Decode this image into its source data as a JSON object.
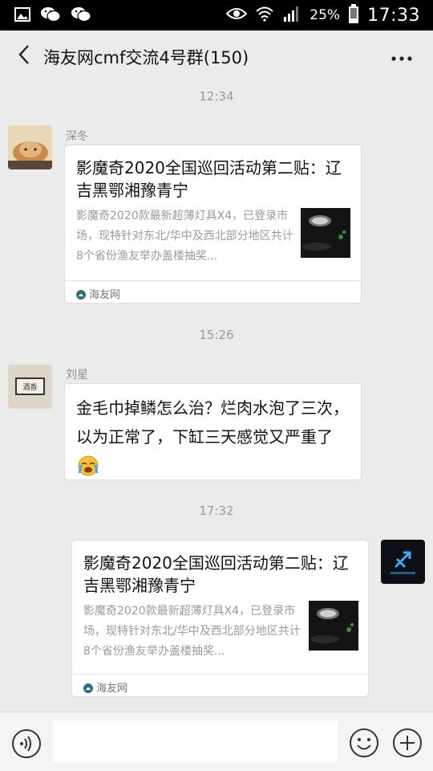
{
  "status_bar": {
    "battery_percent": "25%",
    "time": "17:33",
    "left_icons": [
      "image-icon",
      "wechat-icon",
      "wechat-icon"
    ],
    "right_icons": [
      "eye-icon",
      "wifi-icon",
      "signal-icon",
      "battery-icon"
    ]
  },
  "header": {
    "title": "海友网cmf交流4号群(150)",
    "back_icon": "chevron-left-icon",
    "more_icon": "more-dots-icon"
  },
  "messages": [
    {
      "timestamp": "12:34",
      "sender": "深冬",
      "type": "link_card",
      "title": "影魔奇2020全国巡回活动第二贴：辽吉黑鄂湘豫青宁",
      "desc": "影魔奇2020款最新超薄灯具X4，已登录市场，现特针对东北/华中及西北部分地区共计8个省份渔友举办盖楼抽奖...",
      "source": "海友网"
    },
    {
      "timestamp": "15:26",
      "sender": "刘星",
      "type": "text",
      "text": "金毛巾掉鳞怎么治？烂肉水泡了三次，以为正常了，下缸三天感觉又严重了"
    },
    {
      "timestamp": "17:32",
      "sender": "",
      "type": "link_card",
      "title": "影魔奇2020全国巡回活动第二贴：辽吉黑鄂湘豫青宁",
      "desc": "影魔奇2020款最新超薄灯具X4，已登录市场，现特针对东北/华中及西北部分地区共计8个省份渔友举办盖楼抽奖...",
      "source": "海友网"
    }
  ],
  "input_bar": {
    "voice_icon": "voice-icon",
    "emoji_icon": "emoji-icon",
    "plus_icon": "plus-icon",
    "input_value": ""
  },
  "colors": {
    "background": "#ebebeb",
    "bubble": "#ffffff",
    "timestamp": "#9a9a9a"
  }
}
